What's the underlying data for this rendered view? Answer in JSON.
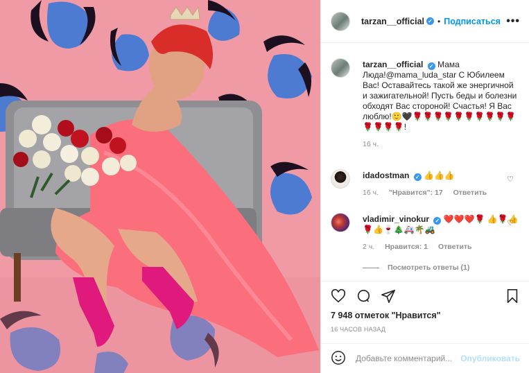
{
  "post": {
    "author": "tarzan__official",
    "follow_label": "Подписаться",
    "more_label": "•••",
    "photo_alt": "Женщина в розовом платье с букетом роз сидит в кресле"
  },
  "caption": {
    "author": "tarzan__official",
    "text": "Мама Люда!@mama_luda_star С Юбилеем Вас! Оставайтесь такой же энергичной и зажигательной! Пусть беды и болезни обходят Вас стороной! Счастья! Я Вас люблю!🙂🖤🌹🌹🌹🌹🌹🌹🌹🌹🌹🌹🌹🌹🌹🌹!",
    "time": "16 ч."
  },
  "comments": [
    {
      "author": "idadostman",
      "text": "👍👍👍",
      "time": "16 ч.",
      "likes": "\"Нравится\": 17",
      "reply": "Ответить"
    },
    {
      "author": "vladimir_vinokur",
      "text": "❤️❤️❤️🌹 👍🌹👍🌹👍🍷🎄🚑🌴🚜",
      "time": "2 ч.",
      "likes": "Нравится: 1",
      "reply": "Ответить"
    }
  ],
  "view_replies": "Посмотреть ответы (1)",
  "likes": "7 948 отметок \"Нравится\"",
  "time_ago": "16 ЧАСОВ НАЗАД",
  "add_comment": {
    "placeholder": "Добавьте комментарий...",
    "publish": "Опубликовать"
  },
  "colors": {
    "accent": "#0095f6",
    "background_pink": "#f0a3ad",
    "leopard_blue": "#4d7bd1",
    "dress_pink": "#fb6f7d"
  },
  "icons": [
    "heart-icon",
    "comment-icon",
    "share-icon",
    "bookmark-icon",
    "smiley-icon",
    "verified-icon"
  ]
}
